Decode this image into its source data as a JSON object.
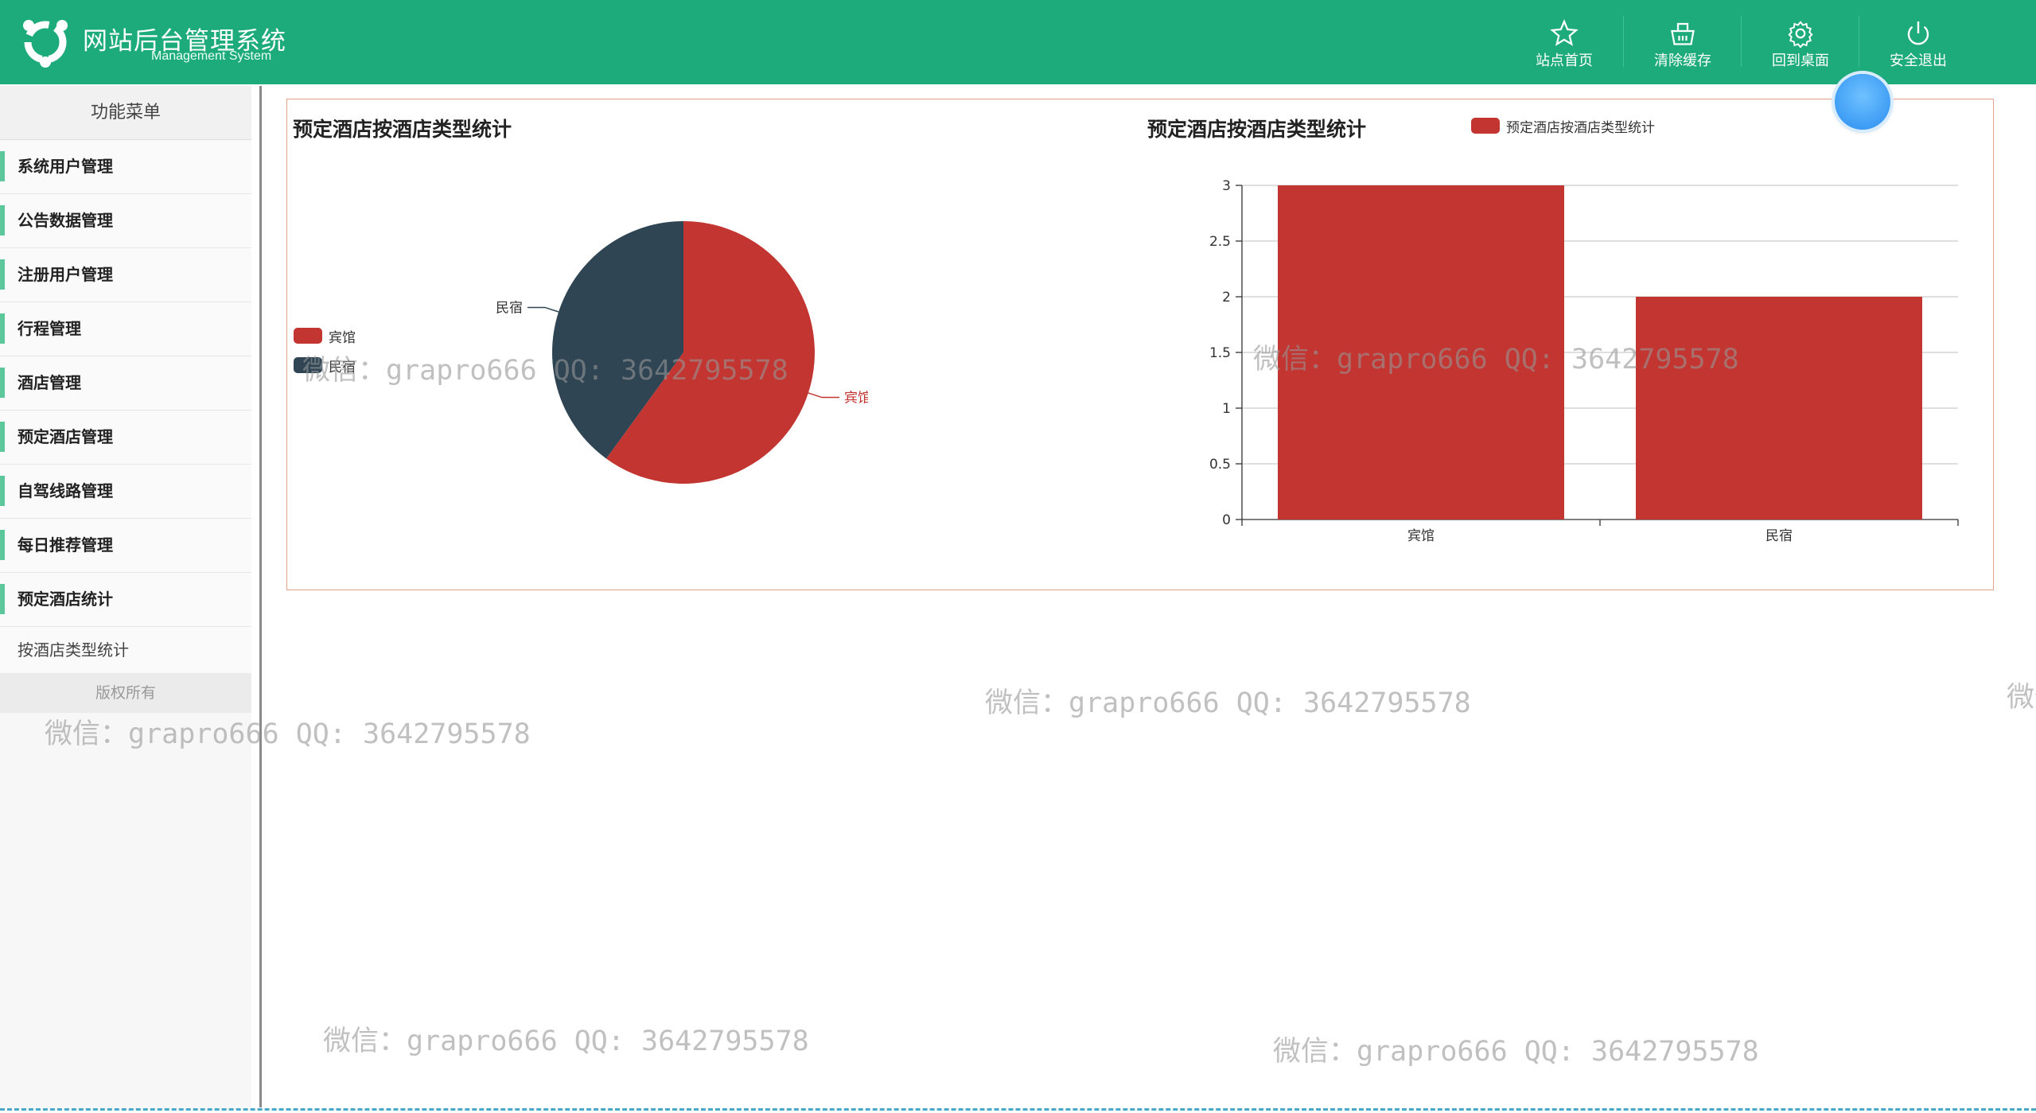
{
  "header": {
    "title": "网站后台管理系统",
    "subtitle": "Management System",
    "nav": [
      {
        "label": "站点首页",
        "icon": "star-icon"
      },
      {
        "label": "清除缓存",
        "icon": "basket-icon"
      },
      {
        "label": "回到桌面",
        "icon": "gear-icon"
      },
      {
        "label": "安全退出",
        "icon": "power-icon"
      }
    ],
    "brand_color": "#1eab7b"
  },
  "sidebar": {
    "heading": "功能菜单",
    "items": [
      {
        "label": "系统用户管理"
      },
      {
        "label": "公告数据管理"
      },
      {
        "label": "注册用户管理"
      },
      {
        "label": "行程管理"
      },
      {
        "label": "酒店管理"
      },
      {
        "label": "预定酒店管理"
      },
      {
        "label": "自驾线路管理"
      },
      {
        "label": "每日推荐管理"
      },
      {
        "label": "预定酒店统计"
      }
    ],
    "sub_item": "按酒店类型统计",
    "footer": "版权所有"
  },
  "watermark": "微信：grapro666 QQ: 3642795578",
  "chart_data": [
    {
      "type": "pie",
      "title": "预定酒店按酒店类型统计",
      "categories": [
        "宾馆",
        "民宿"
      ],
      "values": [
        3,
        2
      ],
      "colors": [
        "#c23531",
        "#2f4554"
      ],
      "legend_position": "left"
    },
    {
      "type": "bar",
      "title": "预定酒店按酒店类型统计",
      "categories": [
        "宾馆",
        "民宿"
      ],
      "series": [
        {
          "name": "预定酒店按酒店类型统计",
          "values": [
            3,
            2
          ]
        }
      ],
      "ylim": [
        0,
        3
      ],
      "yticks": [
        "0",
        "0.5",
        "1",
        "1.5",
        "2",
        "2.5",
        "3"
      ],
      "grid": true,
      "legend_position": "top",
      "color": "#c23531"
    }
  ]
}
